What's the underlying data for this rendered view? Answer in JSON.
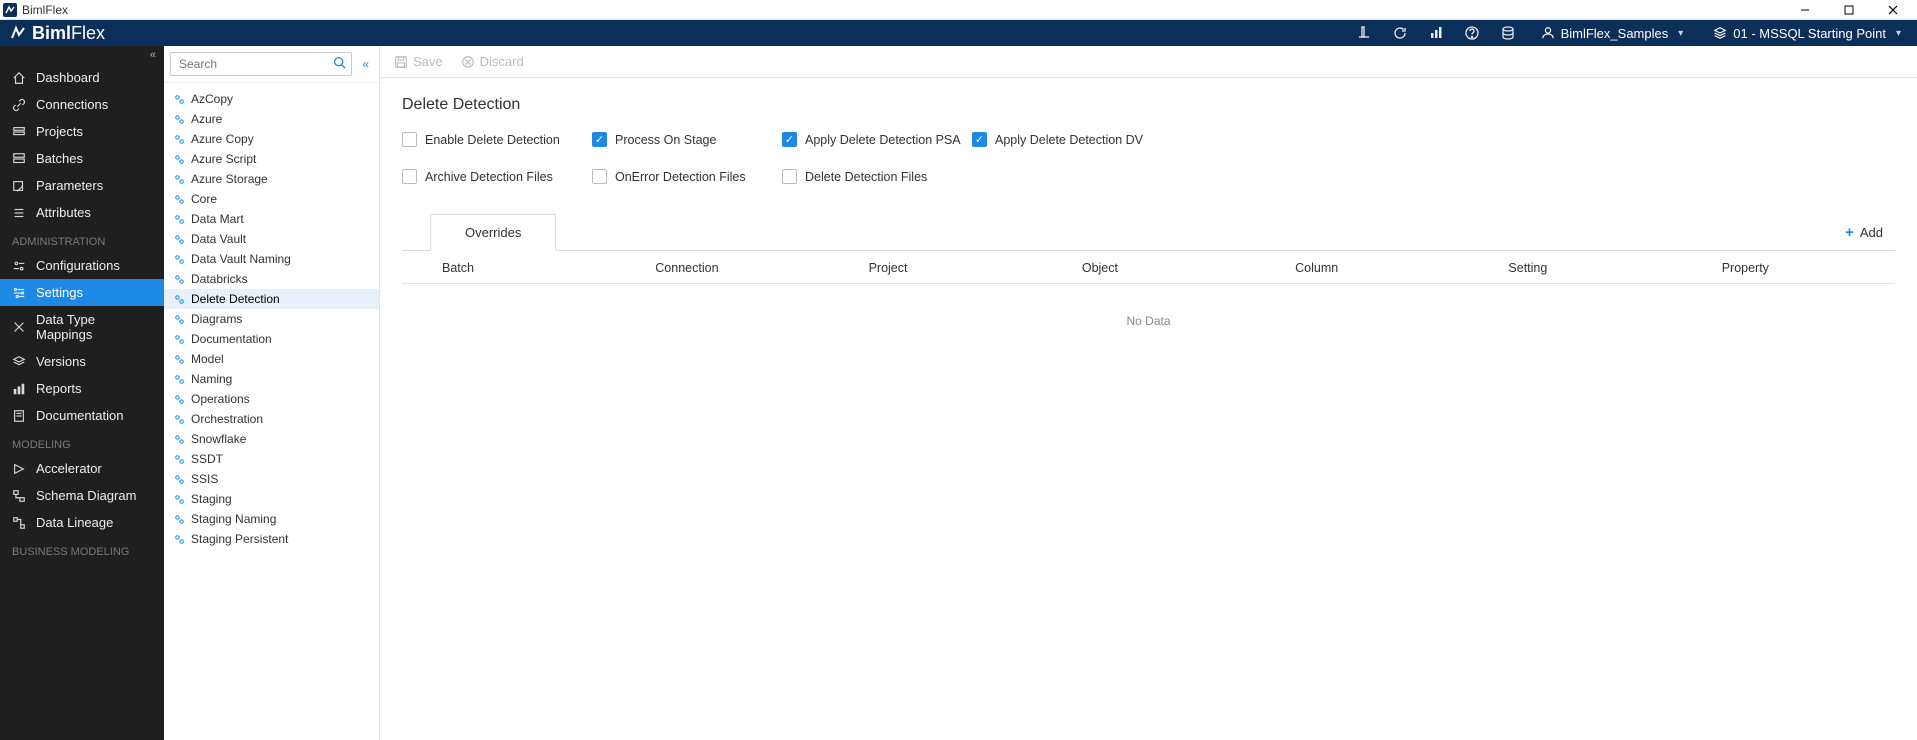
{
  "window": {
    "title": "BimlFlex"
  },
  "brand": {
    "part1": "Biml",
    "part2": "Flex"
  },
  "topnav": {
    "customer": "BimlFlex_Samples",
    "version": "01 - MSSQL Starting Point"
  },
  "sidebar": {
    "collapse_glyph": "«",
    "items_top": [
      {
        "label": "Dashboard",
        "icon": "home-icon"
      },
      {
        "label": "Connections",
        "icon": "link-icon"
      },
      {
        "label": "Projects",
        "icon": "projects-icon"
      },
      {
        "label": "Batches",
        "icon": "batches-icon"
      },
      {
        "label": "Parameters",
        "icon": "params-icon"
      },
      {
        "label": "Attributes",
        "icon": "attr-icon"
      }
    ],
    "section_admin": "ADMINISTRATION",
    "items_admin": [
      {
        "label": "Configurations",
        "icon": "config-icon",
        "active": false
      },
      {
        "label": "Settings",
        "icon": "settings-icon",
        "active": true
      },
      {
        "label": "Data Type Mappings",
        "icon": "mapping-icon",
        "active": false
      },
      {
        "label": "Versions",
        "icon": "versions-icon",
        "active": false
      },
      {
        "label": "Reports",
        "icon": "reports-icon",
        "active": false
      },
      {
        "label": "Documentation",
        "icon": "doc-icon",
        "active": false
      }
    ],
    "section_modeling": "MODELING",
    "items_modeling": [
      {
        "label": "Accelerator",
        "icon": "accel-icon"
      },
      {
        "label": "Schema Diagram",
        "icon": "schema-icon"
      },
      {
        "label": "Data Lineage",
        "icon": "lineage-icon"
      }
    ],
    "section_business": "BUSINESS MODELING"
  },
  "settings_panel": {
    "search_placeholder": "Search",
    "collapse_glyph": "«",
    "items": [
      "AzCopy",
      "Azure",
      "Azure Copy",
      "Azure Script",
      "Azure Storage",
      "Core",
      "Data Mart",
      "Data Vault",
      "Data Vault Naming",
      "Databricks",
      "Delete Detection",
      "Diagrams",
      "Documentation",
      "Model",
      "Naming",
      "Operations",
      "Orchestration",
      "Snowflake",
      "SSDT",
      "SSIS",
      "Staging",
      "Staging Naming",
      "Staging Persistent"
    ],
    "active_index": 10
  },
  "toolbar": {
    "save": "Save",
    "discard": "Discard"
  },
  "page": {
    "title": "Delete Detection",
    "checks_row1": [
      {
        "label": "Enable Delete Detection",
        "checked": false
      },
      {
        "label": "Process On Stage",
        "checked": true
      },
      {
        "label": "Apply Delete Detection PSA",
        "checked": true
      },
      {
        "label": "Apply Delete Detection DV",
        "checked": true
      }
    ],
    "checks_row2": [
      {
        "label": "Archive Detection Files",
        "checked": false
      },
      {
        "label": "OnError Detection Files",
        "checked": false
      },
      {
        "label": "Delete Detection Files",
        "checked": false
      }
    ],
    "tab": "Overrides",
    "add_label": "Add",
    "grid_columns": [
      "Batch",
      "Connection",
      "Project",
      "Object",
      "Column",
      "Setting",
      "Property"
    ],
    "no_data": "No Data"
  }
}
